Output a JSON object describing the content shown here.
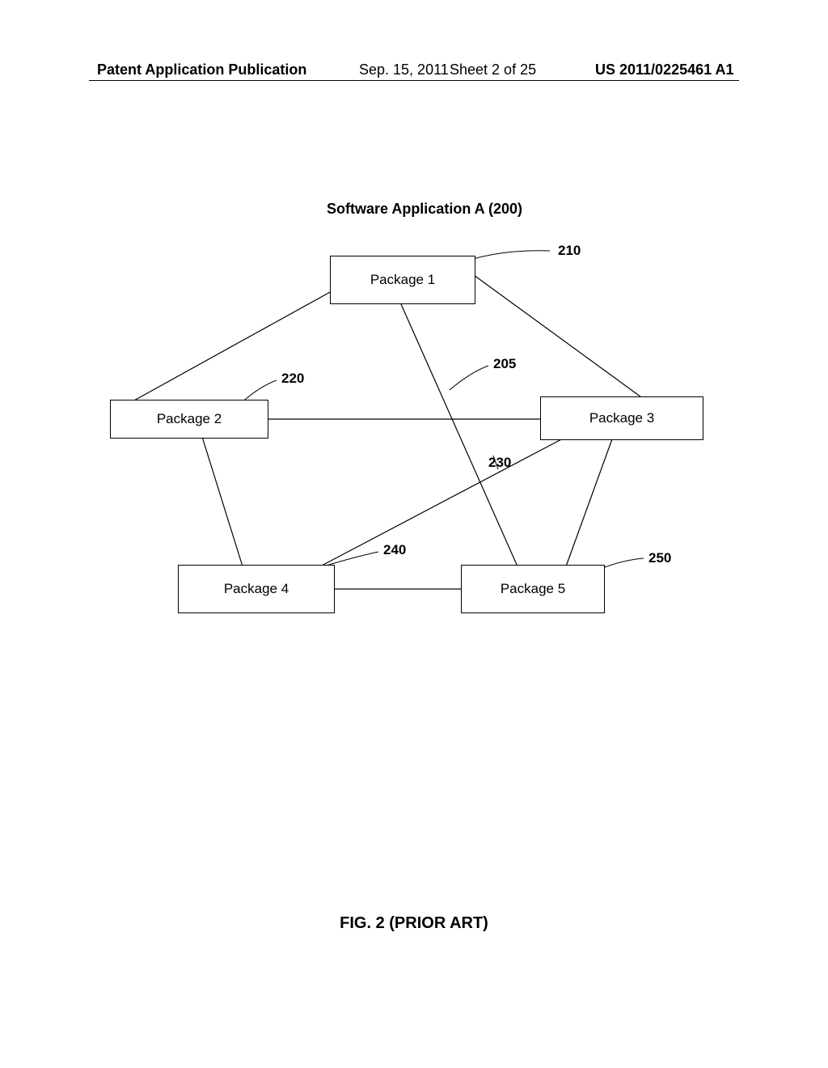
{
  "header": {
    "pub_type": "Patent Application Publication",
    "date": "Sep. 15, 2011",
    "sheet": "Sheet 2 of 25",
    "pub_num": "US 2011/0225461 A1"
  },
  "diagram": {
    "title": "Software Application A (200)",
    "packages": {
      "p1": "Package 1",
      "p2": "Package 2",
      "p3": "Package 3",
      "p4": "Package 4",
      "p5": "Package 5"
    },
    "refs": {
      "r205": "205",
      "r210": "210",
      "r220": "220",
      "r230": "230",
      "r240": "240",
      "r250": "250"
    }
  },
  "caption": "FIG. 2 (PRIOR ART)"
}
